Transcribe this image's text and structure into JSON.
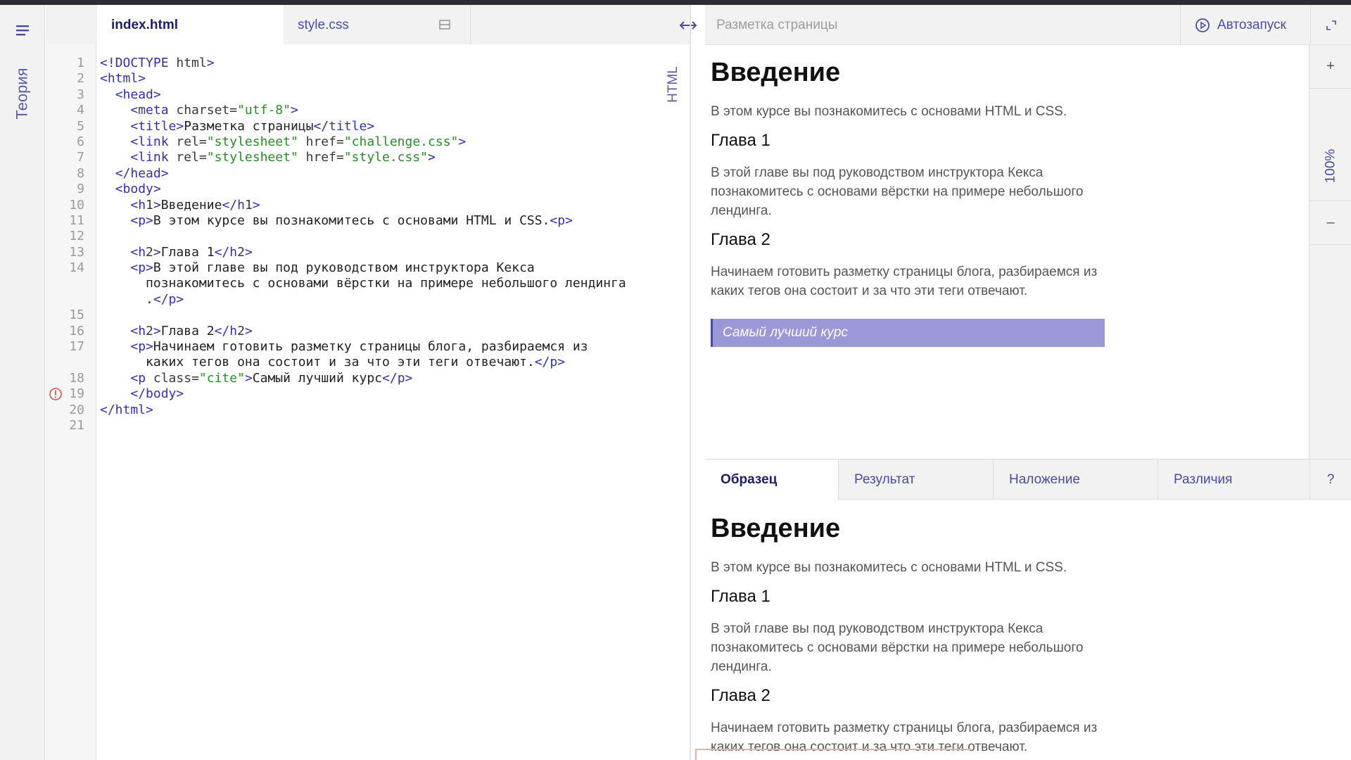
{
  "sidebar": {
    "theory_label": "Теория"
  },
  "editor_tabs": [
    {
      "label": "index.html",
      "active": true
    },
    {
      "label": "style.css",
      "active": false
    }
  ],
  "editor": {
    "mode_label": "HTML",
    "line_numbers": [
      "1",
      "2",
      "3",
      "4",
      "5",
      "6",
      "7",
      "8",
      "9",
      "10",
      "11",
      "12",
      "13",
      "14",
      "15",
      "16",
      "17",
      "18",
      "19",
      "20",
      "21"
    ],
    "error_line": "19",
    "code_lines": [
      "<!DOCTYPE html>",
      "<html>",
      "  <head>",
      "    <meta charset=\"utf-8\">",
      "    <title>Разметка страницы</title>",
      "    <link rel=\"stylesheet\" href=\"challenge.css\">",
      "    <link rel=\"stylesheet\" href=\"style.css\">",
      "  </head>",
      "  <body>",
      "    <h1>Введение</h1>",
      "    <p>В этом курсе вы познакомитесь с основами HTML и CSS.<p>",
      "",
      "    <h2>Глава 1</h2>",
      "    <p>В этой главе вы под руководством инструктора Кекса",
      "      познакомитесь с основами вёрстки на примере небольшого лендинга",
      "      .</p>",
      "",
      "    <h2>Глава 2</h2>",
      "    <p>Начинаем готовить разметку страницы блога, разбираемся из",
      "      каких тегов она состоит и за что эти теги отвечают.</p>",
      "    <p class=\"cite\">Самый лучший курс</p>",
      "    </body>",
      "</html>",
      ""
    ]
  },
  "preview_header": {
    "title": "Разметка страницы",
    "autorun_label": "Автозапуск"
  },
  "zoom": {
    "plus": "+",
    "value": "100%",
    "minus": "–"
  },
  "preview": {
    "h1": "Введение",
    "intro": "В этом курсе вы познакомитесь с основами HTML и CSS.",
    "ch1_title": "Глава 1",
    "ch1_text": "В этой главе вы под руководством инструктора Кекса познакомитесь с основами вёрстки на примере небольшого лендинга.",
    "ch2_title": "Глава 2",
    "ch2_text": "Начинаем готовить разметку страницы блога, разбираемся из каких тегов она состоит и за что эти теги отвечают.",
    "cite": "Самый лучший курс"
  },
  "result_tabs": [
    {
      "label": "Образец",
      "active": true
    },
    {
      "label": "Результат",
      "active": false
    },
    {
      "label": "Наложение",
      "active": false
    },
    {
      "label": "Различия",
      "active": false
    }
  ],
  "help_label": "?",
  "sample": {
    "h1": "Введение",
    "intro": "В этом курсе вы познакомитесь с основами HTML и CSS.",
    "ch1_title": "Глава 1",
    "ch1_text": "В этой главе вы под руководством инструктора Кекса познакомитесь с основами вёрстки на примере небольшого лендинга.",
    "ch2_title": "Глава 2",
    "ch2_text": "Начинаем готовить разметку страницы блога, разбираемся из каких тегов она состоит и за что эти теги отвечают."
  },
  "colors": {
    "accent": "#4a4ca3",
    "cite_bg": "#9a98d6",
    "error": "#d9534f"
  }
}
